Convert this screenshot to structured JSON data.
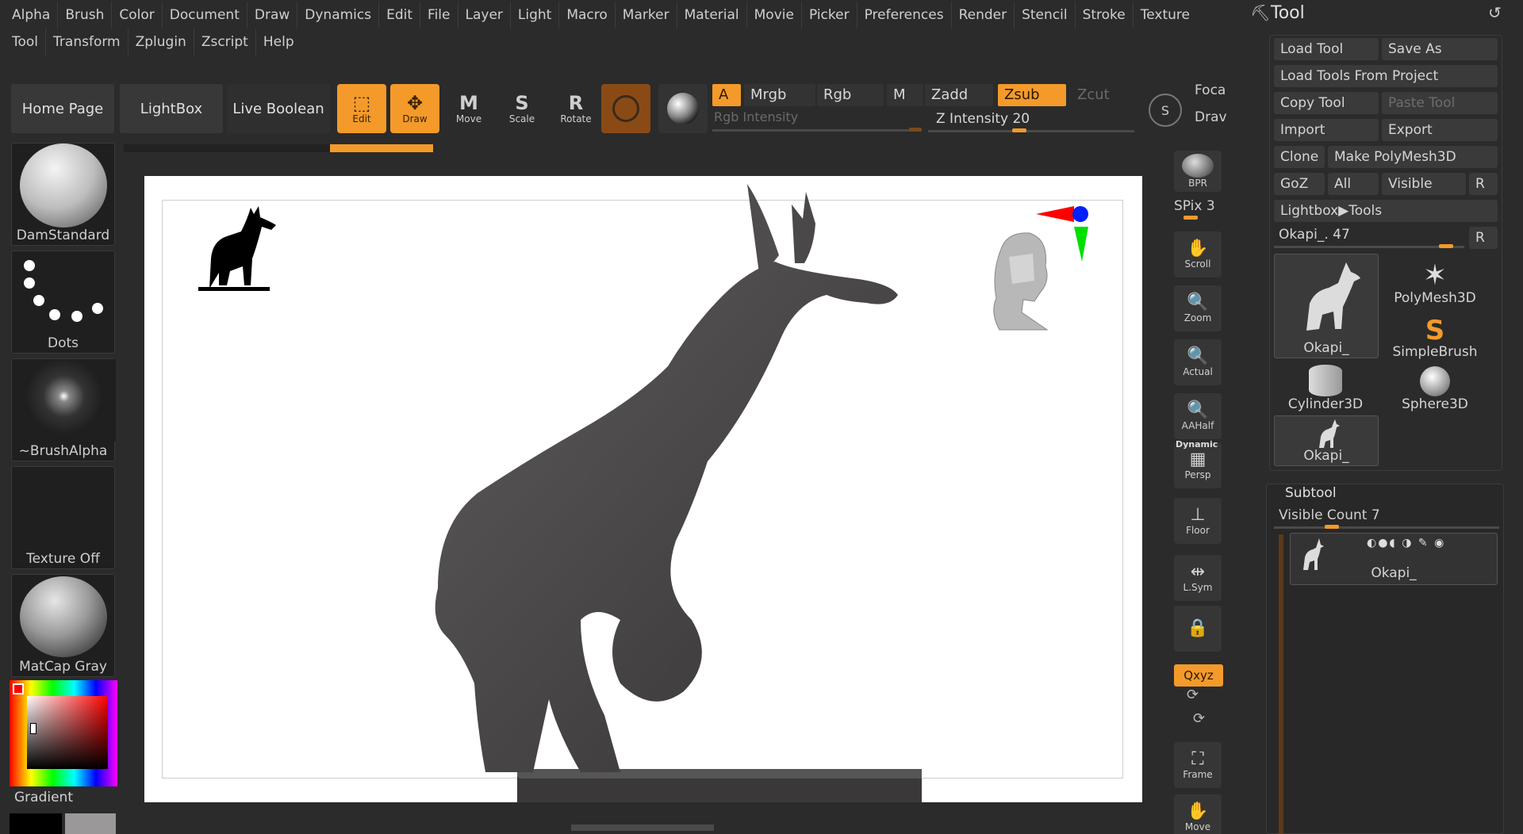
{
  "menu": {
    "row1": [
      "Alpha",
      "Brush",
      "Color",
      "Document",
      "Draw",
      "Dynamics",
      "Edit",
      "File",
      "Layer",
      "Light",
      "Macro",
      "Marker",
      "Material",
      "Movie",
      "Picker",
      "Preferences",
      "Render",
      "Stencil",
      "Stroke",
      "Texture"
    ],
    "row2": [
      "Tool",
      "Transform",
      "Zplugin",
      "Zscript",
      "Help"
    ]
  },
  "top_shelf": {
    "home_page": "Home Page",
    "lightbox": "LightBox",
    "live_boolean": "Live Boolean",
    "tools": [
      {
        "label": "Edit",
        "glyph": "⬚"
      },
      {
        "label": "Draw",
        "glyph": "✥"
      },
      {
        "label": "Move",
        "glyph": "M"
      },
      {
        "label": "Scale",
        "glyph": "S"
      },
      {
        "label": "Rotate",
        "glyph": "R"
      }
    ],
    "a_label": "A",
    "mrgb": "Mrgb",
    "rgb": "Rgb",
    "m": "M",
    "zadd": "Zadd",
    "zsub": "Zsub",
    "zcut": "Zcut",
    "rgb_intensity": "Rgb Intensity",
    "z_intensity": "Z Intensity 20",
    "focal": "Foca",
    "draw_size": "Drav"
  },
  "left_shelf": {
    "brush": "DamStandard",
    "stroke": "Dots",
    "alpha": "~BrushAlpha",
    "texture": "Texture Off",
    "material": "MatCap Gray",
    "gradient": "Gradient"
  },
  "right_shelf": [
    {
      "name": "bpr",
      "label": "BPR",
      "glyph": ""
    },
    {
      "name": "scroll",
      "label": "Scroll",
      "glyph": "✋"
    },
    {
      "name": "zoom",
      "label": "Zoom",
      "glyph": "🔍"
    },
    {
      "name": "actual",
      "label": "Actual",
      "glyph": "🔍"
    },
    {
      "name": "aahalf",
      "label": "AAHalf",
      "glyph": "🔍"
    },
    {
      "name": "persp",
      "label": "Persp",
      "glyph": "▦"
    },
    {
      "name": "floor",
      "label": "Floor",
      "glyph": "⊥"
    },
    {
      "name": "lsym",
      "label": "L.Sym",
      "glyph": "⇹"
    },
    {
      "name": "lock",
      "label": "",
      "glyph": "🔒"
    },
    {
      "name": "frame",
      "label": "Frame",
      "glyph": "⛶"
    },
    {
      "name": "move",
      "label": "Move",
      "glyph": "✋"
    }
  ],
  "spix": "SPix 3",
  "dynamic": "Dynamic",
  "xyz": "Qxyz",
  "tool_panel": {
    "title": "Tool",
    "load_tool": "Load Tool",
    "save_as": "Save As",
    "load_from_project": "Load Tools From Project",
    "copy_tool": "Copy Tool",
    "paste_tool": "Paste Tool",
    "import": "Import",
    "export": "Export",
    "clone": "Clone",
    "make_polymesh": "Make PolyMesh3D",
    "goz": "GoZ",
    "all": "All",
    "visible": "Visible",
    "r": "R",
    "lightbox_tools": "Lightbox▶Tools",
    "current_tool": "Okapi_. 47",
    "tools": [
      "Okapi_",
      "PolyMesh3D",
      "SimpleBrush",
      "Cylinder3D",
      "Sphere3D",
      "Okapi_"
    ]
  },
  "subtool": {
    "title": "Subtool",
    "visible_count": "Visible Count 7",
    "items": [
      "Okapi_"
    ]
  },
  "colors": {
    "accent": "#f39a2b",
    "panel": "#2b2b2b",
    "canvas": "#ffffff",
    "model": "#4a4848"
  }
}
